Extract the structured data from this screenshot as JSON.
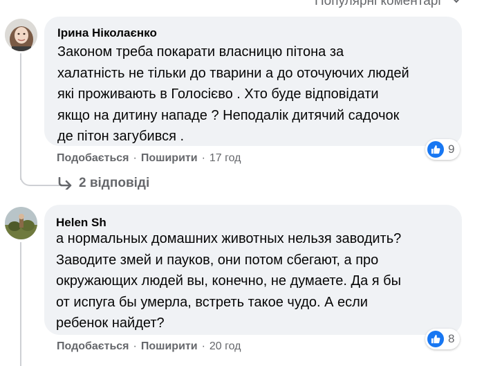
{
  "sort": {
    "label": "Популярні коментарі"
  },
  "comments": [
    {
      "author": "Ірина Ніколаєнко",
      "lines": [
        "Законом треба покарати власницю пітона за",
        "халатність не тільки до тварини а до оточуючих людей",
        "які проживають в Голосієво . Хто буде відповідати",
        "якщо на дитину нападе ? Неподалік дитячий садочок",
        "де пітон загубився ."
      ],
      "reaction_count": "9",
      "like_label": "Подобається",
      "share_label": "Поширити",
      "time": "17 год",
      "replies_label": "2 відповіді"
    },
    {
      "author": "Helen Sh",
      "lines": [
        "а нормальных домашних животных нельзя заводить?",
        "Заводите змей и пауков, они потом сбегают, а про",
        "окружающих людей вы, конечно, не думаете. Да я бы",
        "от испуга бы умерла, встреть такое чудо. А если",
        "ребенок найдет?"
      ],
      "reaction_count": "8",
      "like_label": "Подобається",
      "share_label": "Поширити",
      "time": "20 год"
    }
  ],
  "separator": "·",
  "colors": {
    "bubble": "#f0f2f5",
    "secondary_text": "#65676b",
    "like_blue": "#1877f2"
  }
}
